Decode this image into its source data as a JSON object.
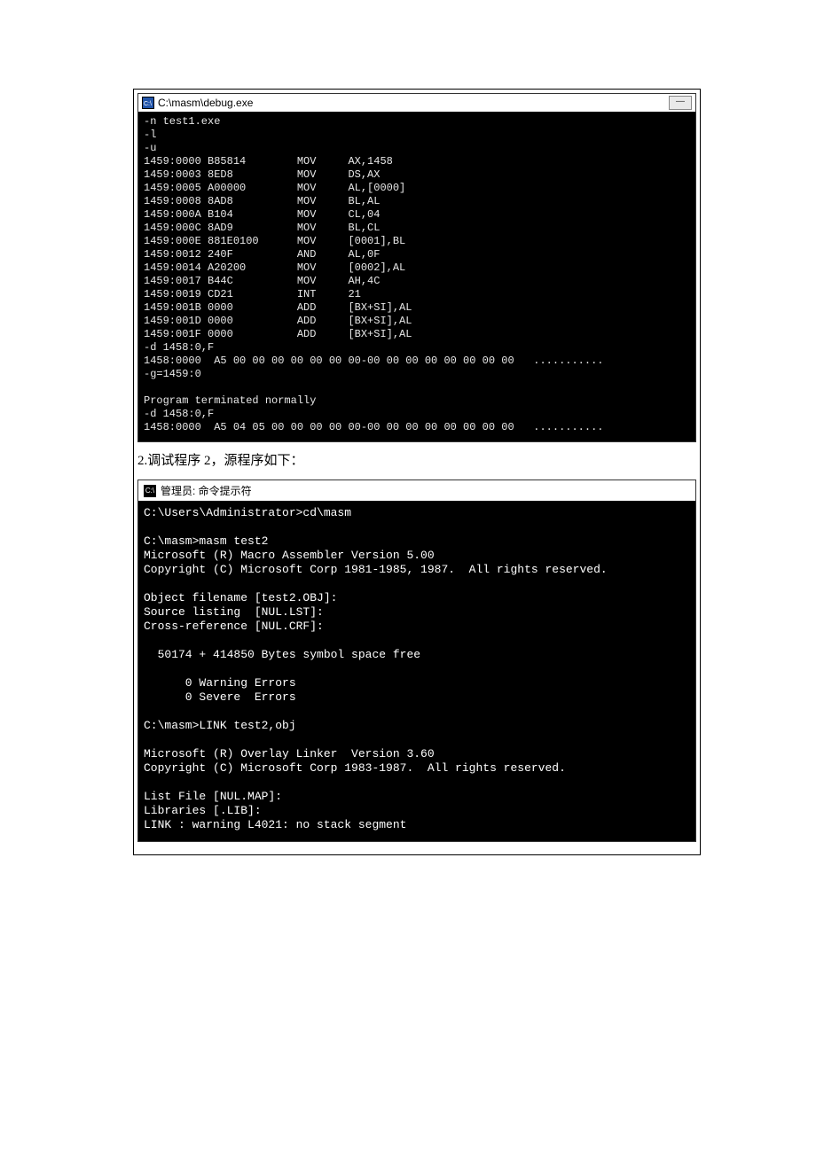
{
  "window1": {
    "title": "C:\\masm\\debug.exe",
    "icon_name": "cmd-icon",
    "terminal": "-n test1.exe\n-l\n-u\n1459:0000 B85814        MOV     AX,1458\n1459:0003 8ED8          MOV     DS,AX\n1459:0005 A00000        MOV     AL,[0000]\n1459:0008 8AD8          MOV     BL,AL\n1459:000A B104          MOV     CL,04\n1459:000C 8AD9          MOV     BL,CL\n1459:000E 881E0100      MOV     [0001],BL\n1459:0012 240F          AND     AL,0F\n1459:0014 A20200        MOV     [0002],AL\n1459:0017 B44C          MOV     AH,4C\n1459:0019 CD21          INT     21\n1459:001B 0000          ADD     [BX+SI],AL\n1459:001D 0000          ADD     [BX+SI],AL\n1459:001F 0000          ADD     [BX+SI],AL\n-d 1458:0,F\n1458:0000  A5 00 00 00 00 00 00 00-00 00 00 00 00 00 00 00   ...........\n-g=1459:0\n\nProgram terminated normally\n-d 1458:0,F\n1458:0000  A5 04 05 00 00 00 00 00-00 00 00 00 00 00 00 00   ..........."
  },
  "caption": "2.调试程序 2，源程序如下：",
  "window2": {
    "title": "管理员: 命令提示符",
    "icon_label": "C:\\",
    "terminal": "C:\\Users\\Administrator>cd\\masm\n\nC:\\masm>masm test2\nMicrosoft (R) Macro Assembler Version 5.00\nCopyright (C) Microsoft Corp 1981-1985, 1987.  All rights reserved.\n\nObject filename [test2.OBJ]:\nSource listing  [NUL.LST]:\nCross-reference [NUL.CRF]:\n\n  50174 + 414850 Bytes symbol space free\n\n      0 Warning Errors\n      0 Severe  Errors\n\nC:\\masm>LINK test2,obj\n\nMicrosoft (R) Overlay Linker  Version 3.60\nCopyright (C) Microsoft Corp 1983-1987.  All rights reserved.\n\nList File [NUL.MAP]:\nLibraries [.LIB]:\nLINK : warning L4021: no stack segment\n"
  }
}
